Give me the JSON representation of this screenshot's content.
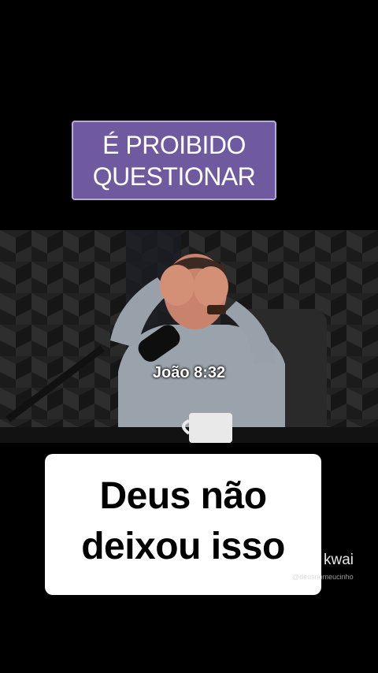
{
  "top_caption": {
    "line1": "É PROIBIDO",
    "line2": "QUESTIONAR",
    "background_color": "#6f5aa0",
    "border_color": "#b9a9dc"
  },
  "video": {
    "verse_caption": "João 8:32"
  },
  "bottom_caption": {
    "line1": "Deus não",
    "line2": "deixou isso"
  },
  "watermark": {
    "brand": "kwai",
    "handle": "@deusnomeucinho",
    "icon": "kwai-logo-icon"
  }
}
